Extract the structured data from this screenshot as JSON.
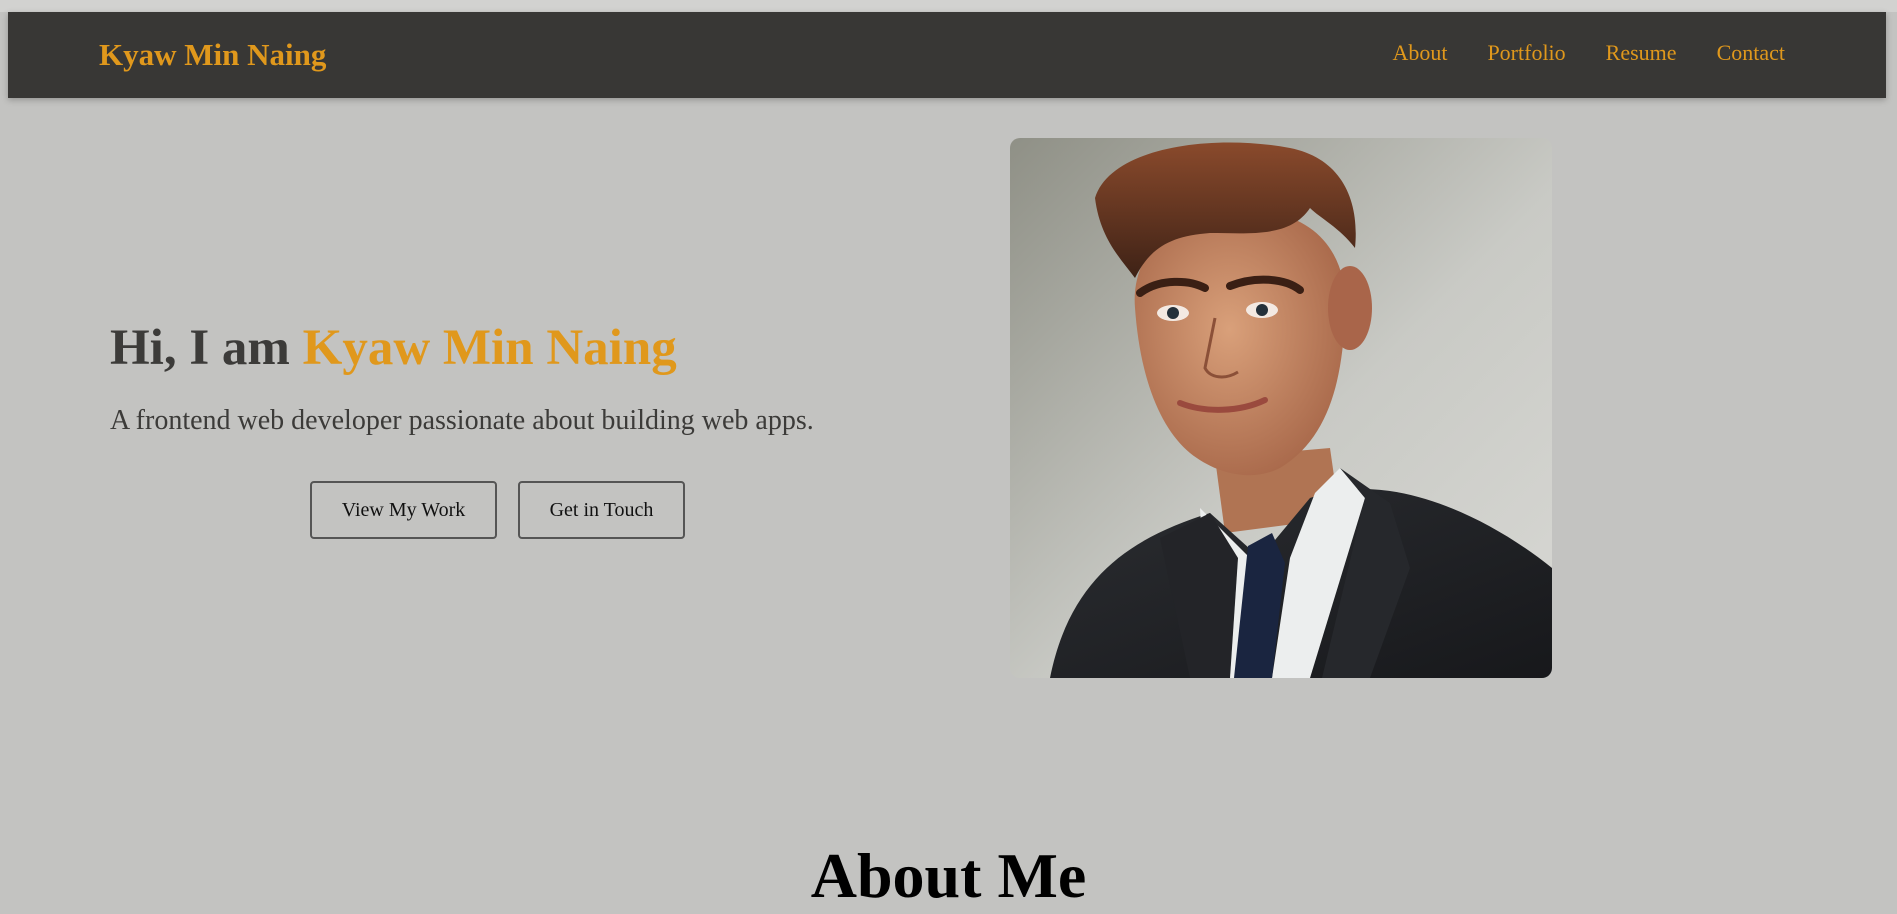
{
  "nav": {
    "brand": "Kyaw Min Naing",
    "links": [
      "About",
      "Portfolio",
      "Resume",
      "Contact"
    ]
  },
  "hero": {
    "greeting": "Hi, I am ",
    "name": "Kyaw Min Naing",
    "subtitle": "A frontend web developer passionate about building web apps.",
    "buttons": {
      "view_work": "View My Work",
      "get_in_touch": "Get in Touch"
    },
    "portrait_alt": "portrait of a young man in a dark suit and tie"
  },
  "about": {
    "title": "About Me"
  },
  "colors": {
    "accent": "#e0981c",
    "nav_background": "#383735",
    "page_background": "#c3c3c1",
    "text_dark": "#3c3b39"
  }
}
